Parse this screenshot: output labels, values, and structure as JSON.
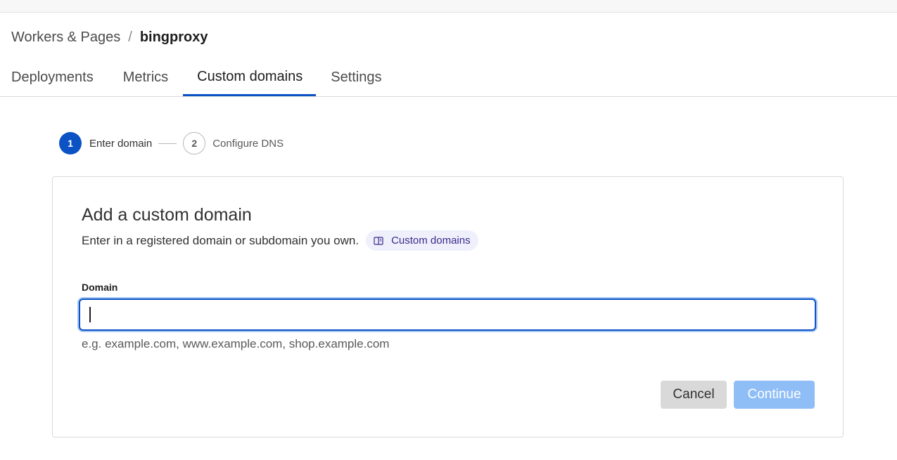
{
  "breadcrumb": {
    "parent": "Workers & Pages",
    "separator": "/",
    "current": "bingproxy"
  },
  "tabs": [
    {
      "label": "Deployments",
      "active": false
    },
    {
      "label": "Metrics",
      "active": false
    },
    {
      "label": "Custom domains",
      "active": true
    },
    {
      "label": "Settings",
      "active": false
    }
  ],
  "stepper": {
    "steps": [
      {
        "number": "1",
        "label": "Enter domain",
        "active": true
      },
      {
        "number": "2",
        "label": "Configure DNS",
        "active": false
      }
    ]
  },
  "card": {
    "title": "Add a custom domain",
    "description": "Enter in a registered domain or subdomain you own.",
    "doc_chip": {
      "icon": "book-icon",
      "label": "Custom domains"
    },
    "field_label": "Domain",
    "input_value": "",
    "helper_text": "e.g. example.com, www.example.com, shop.example.com",
    "cancel_label": "Cancel",
    "continue_label": "Continue"
  },
  "colors": {
    "accent": "#0b52c4",
    "continue_disabled": "#8fbef7",
    "chip_background": "#eef0fb",
    "chip_text": "#3a2a8c"
  }
}
